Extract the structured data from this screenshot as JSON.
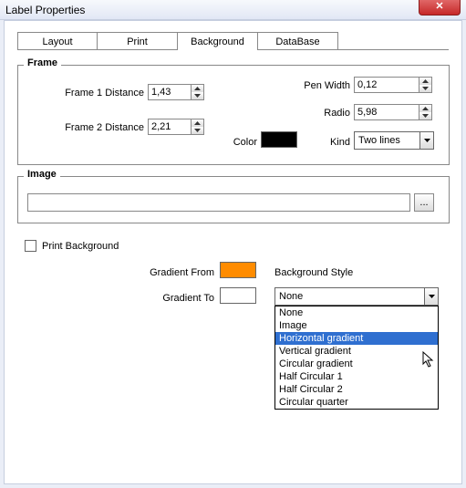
{
  "window": {
    "title": "Label Properties"
  },
  "tabs": {
    "layout": "Layout",
    "print": "Print",
    "background": "Background",
    "database": "DataBase"
  },
  "frame": {
    "legend": "Frame",
    "f1_label": "Frame 1 Distance",
    "f1_value": "1,43",
    "f2_label": "Frame 2 Distance",
    "f2_value": "2,21",
    "penwidth_label": "Pen Width",
    "penwidth_value": "0,12",
    "radio_label": "Radio",
    "radio_value": "5,98",
    "color_label": "Color",
    "color_value": "#000000",
    "kind_label": "Kind",
    "kind_value": "Two lines"
  },
  "image": {
    "legend": "Image",
    "path": "",
    "browse": "..."
  },
  "print_bg_label": "Print Background",
  "grad_from_label": "Gradient From",
  "grad_from_color": "#ff8c00",
  "grad_to_label": "Gradient To",
  "grad_to_color": "#ffffff",
  "bgstyle_label": "Background Style",
  "bgstyle_value": "None",
  "bgstyle_options": {
    "o0": "None",
    "o1": "Image",
    "o2": "Horizontal gradient",
    "o3": "Vertical gradient",
    "o4": "Circular gradient",
    "o5": "Half Circular 1",
    "o6": "Half Circular 2",
    "o7": "Circular quarter"
  }
}
